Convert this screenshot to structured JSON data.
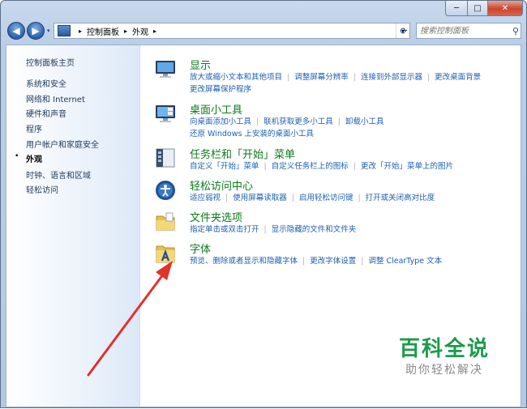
{
  "window": {
    "caption_min": "─",
    "caption_max": "□",
    "caption_close": "✕"
  },
  "nav": {
    "back": "◀",
    "forward": "▶",
    "dropdown": "▾"
  },
  "address": {
    "crumbs": [
      "控制面板",
      "外观"
    ],
    "sep": "▸"
  },
  "search": {
    "placeholder": "搜索控制面板"
  },
  "sidebar": {
    "home": "控制面板主页",
    "items": [
      {
        "label": "系统和安全"
      },
      {
        "label": "网络和 Internet"
      },
      {
        "label": "硬件和声音"
      },
      {
        "label": "程序"
      },
      {
        "label": "用户帐户和家庭安全"
      },
      {
        "label": "外观",
        "current": true
      },
      {
        "label": "时钟、语言和区域"
      },
      {
        "label": "轻松访问"
      }
    ],
    "bullet": "•"
  },
  "categories": [
    {
      "title": "显示",
      "icon": "display-icon",
      "lines": [
        [
          "放大或缩小文本和其他项目",
          "调整屏幕分辨率",
          "连接到外部显示器",
          "更改桌面背景"
        ],
        [
          "更改屏幕保护程序"
        ]
      ]
    },
    {
      "title": "桌面小工具",
      "icon": "gadgets-icon",
      "lines": [
        [
          "向桌面添加小工具",
          "联机获取更多小工具",
          "卸载小工具"
        ],
        [
          "还原 Windows 上安装的桌面小工具"
        ]
      ]
    },
    {
      "title": "任务栏和「开始」菜单",
      "icon": "taskbar-icon",
      "lines": [
        [
          "自定义「开始」菜单",
          "自定义任务栏上的图标",
          "更改「开始」菜单上的图片"
        ]
      ]
    },
    {
      "title": "轻松访问中心",
      "icon": "ease-of-access-icon",
      "lines": [
        [
          "适应弱视",
          "使用屏幕读取器",
          "启用轻松访问键",
          "打开或关闭高对比度"
        ]
      ]
    },
    {
      "title": "文件夹选项",
      "icon": "folder-options-icon",
      "lines": [
        [
          "指定单击或双击打开",
          "显示隐藏的文件和文件夹"
        ]
      ]
    },
    {
      "title": "字体",
      "icon": "fonts-icon",
      "lines": [
        [
          "预览、删除或者显示和隐藏字体",
          "更改字体设置",
          "调整 ClearType 文本"
        ]
      ]
    }
  ],
  "watermark": {
    "main": "百科全说",
    "sub": "助你轻松解决"
  },
  "colors": {
    "category_title": "#0b7a1a",
    "link": "#1e5fb3",
    "annotation_arrow": "#e0332b",
    "watermark": "#1c9a4a"
  }
}
